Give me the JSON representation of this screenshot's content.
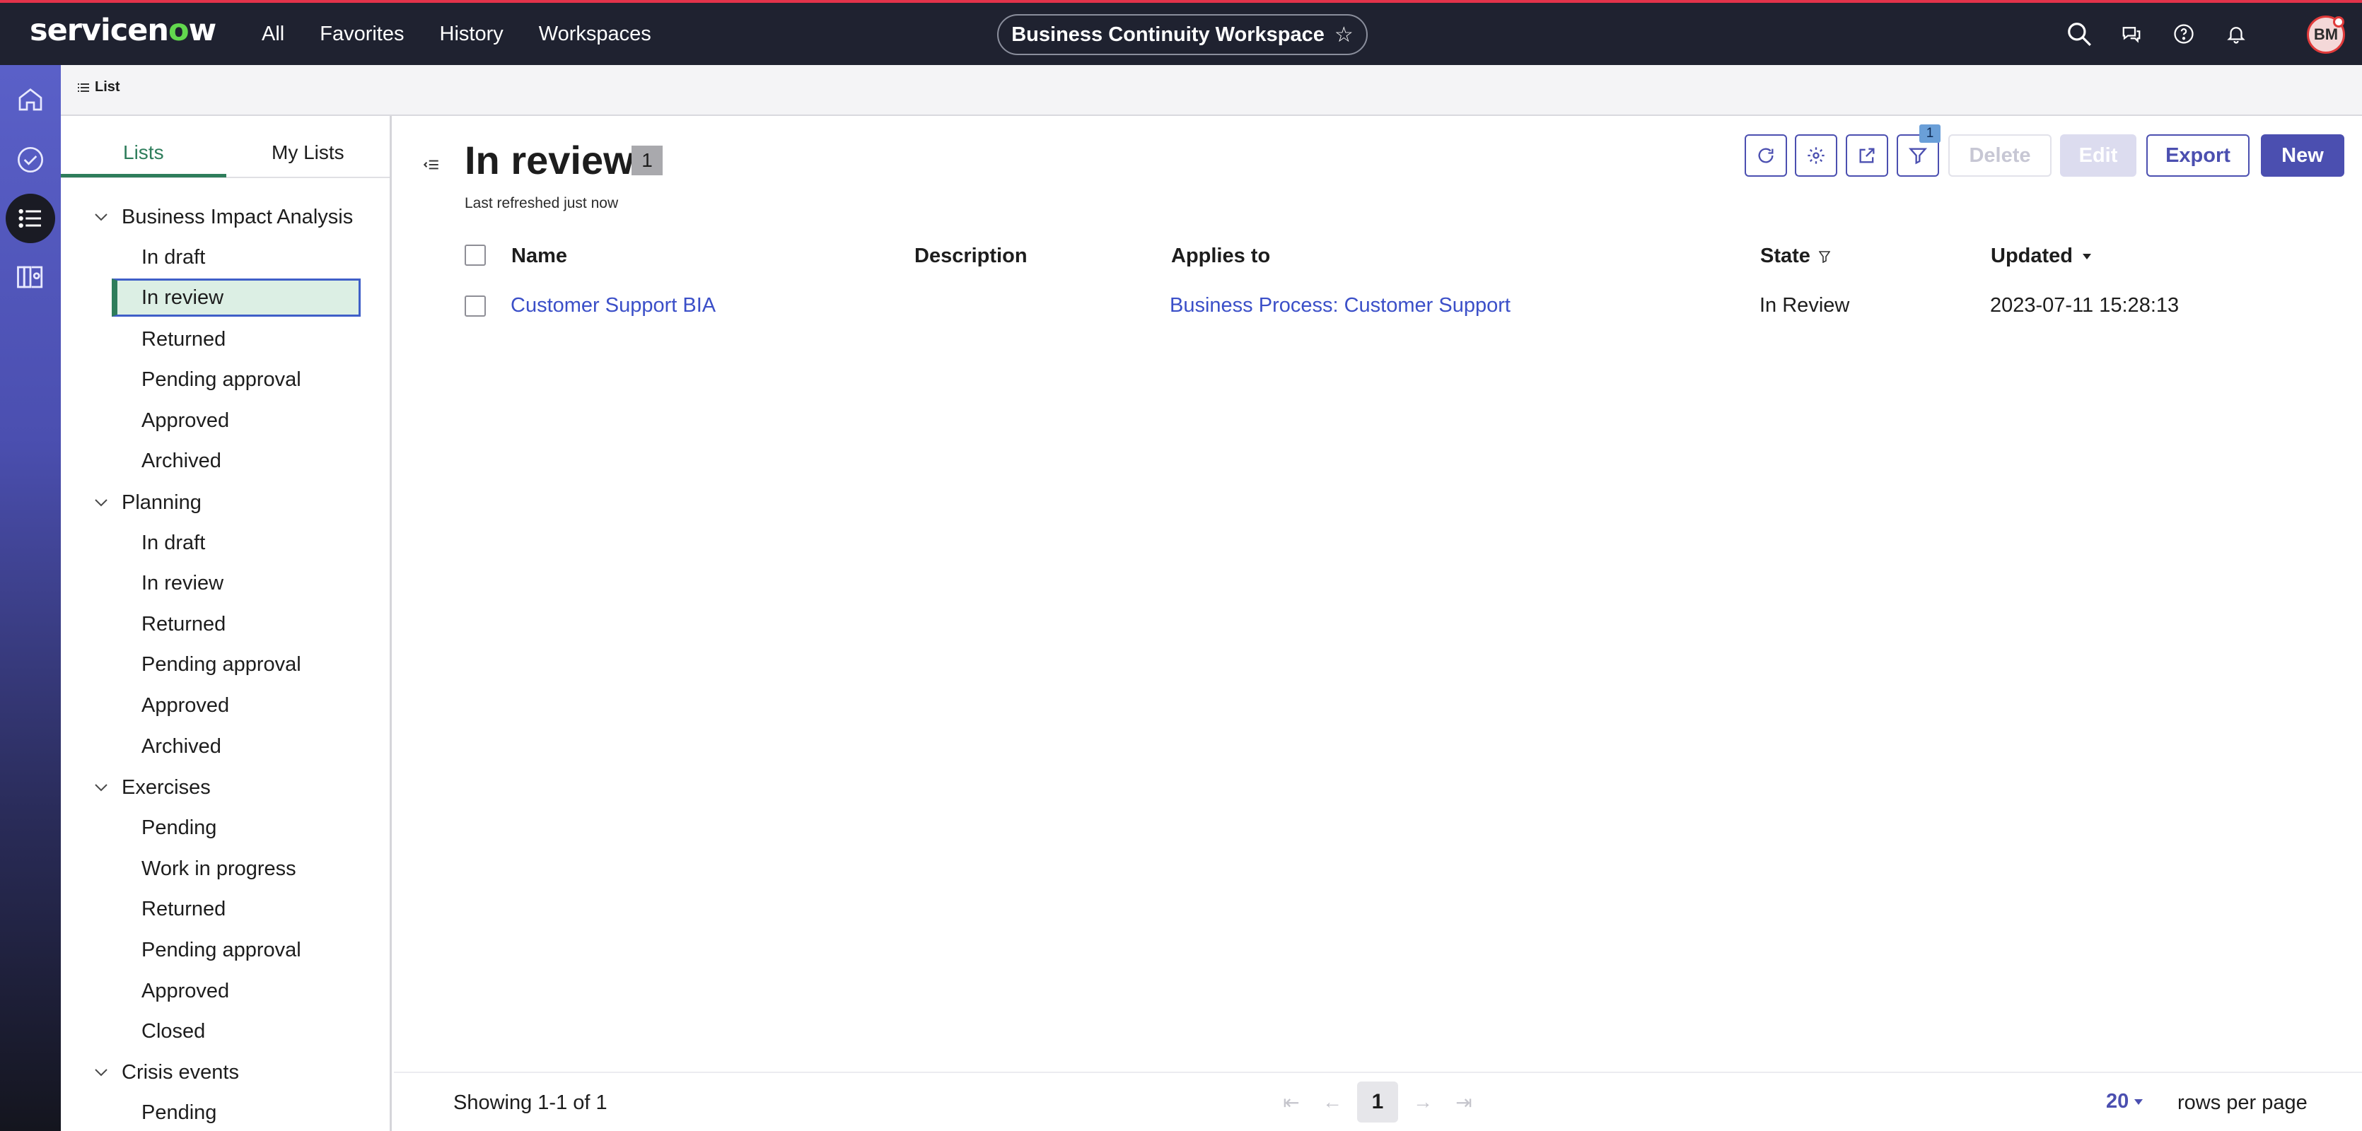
{
  "app": {
    "logo_text": "servicenow",
    "nav": [
      "All",
      "Favorites",
      "History",
      "Workspaces"
    ],
    "workspace_title": "Business Continuity Workspace",
    "user_initials": "BM"
  },
  "tab_strip": {
    "tab_label": "List"
  },
  "lists_panel": {
    "tabs": [
      "Lists",
      "My Lists"
    ],
    "groups": [
      {
        "label": "Business Impact Analysis",
        "items": [
          "In draft",
          "In review",
          "Returned",
          "Pending approval",
          "Approved",
          "Archived"
        ]
      },
      {
        "label": "Planning",
        "items": [
          "In draft",
          "In review",
          "Returned",
          "Pending approval",
          "Approved",
          "Archived"
        ]
      },
      {
        "label": "Exercises",
        "items": [
          "Pending",
          "Work in progress",
          "Returned",
          "Pending approval",
          "Approved",
          "Closed"
        ]
      },
      {
        "label": "Crisis events",
        "items": [
          "Pending"
        ]
      }
    ],
    "selected": "In review"
  },
  "main": {
    "title": "In review",
    "count": "1",
    "last_refreshed": "Last refreshed just now",
    "filter_count": "1",
    "buttons": {
      "delete": "Delete",
      "edit": "Edit",
      "export": "Export",
      "new": "New"
    },
    "columns": [
      "Name",
      "Description",
      "Applies to",
      "State",
      "Updated"
    ],
    "rows": [
      {
        "name": "Customer Support BIA",
        "description": "",
        "applies_to": "Business Process: Customer Support",
        "state": "In Review",
        "updated": "2023-07-11 15:28:13"
      }
    ],
    "footer": {
      "showing": "Showing 1-1 of 1",
      "current_page": "1",
      "rows_per_page_value": "20",
      "rows_per_page_label": "rows per page"
    }
  },
  "colors": {
    "accent": "#4b4fb0",
    "topbar": "#1f2230",
    "selected_green": "#2e7d5b",
    "link": "#3b4fc8"
  }
}
